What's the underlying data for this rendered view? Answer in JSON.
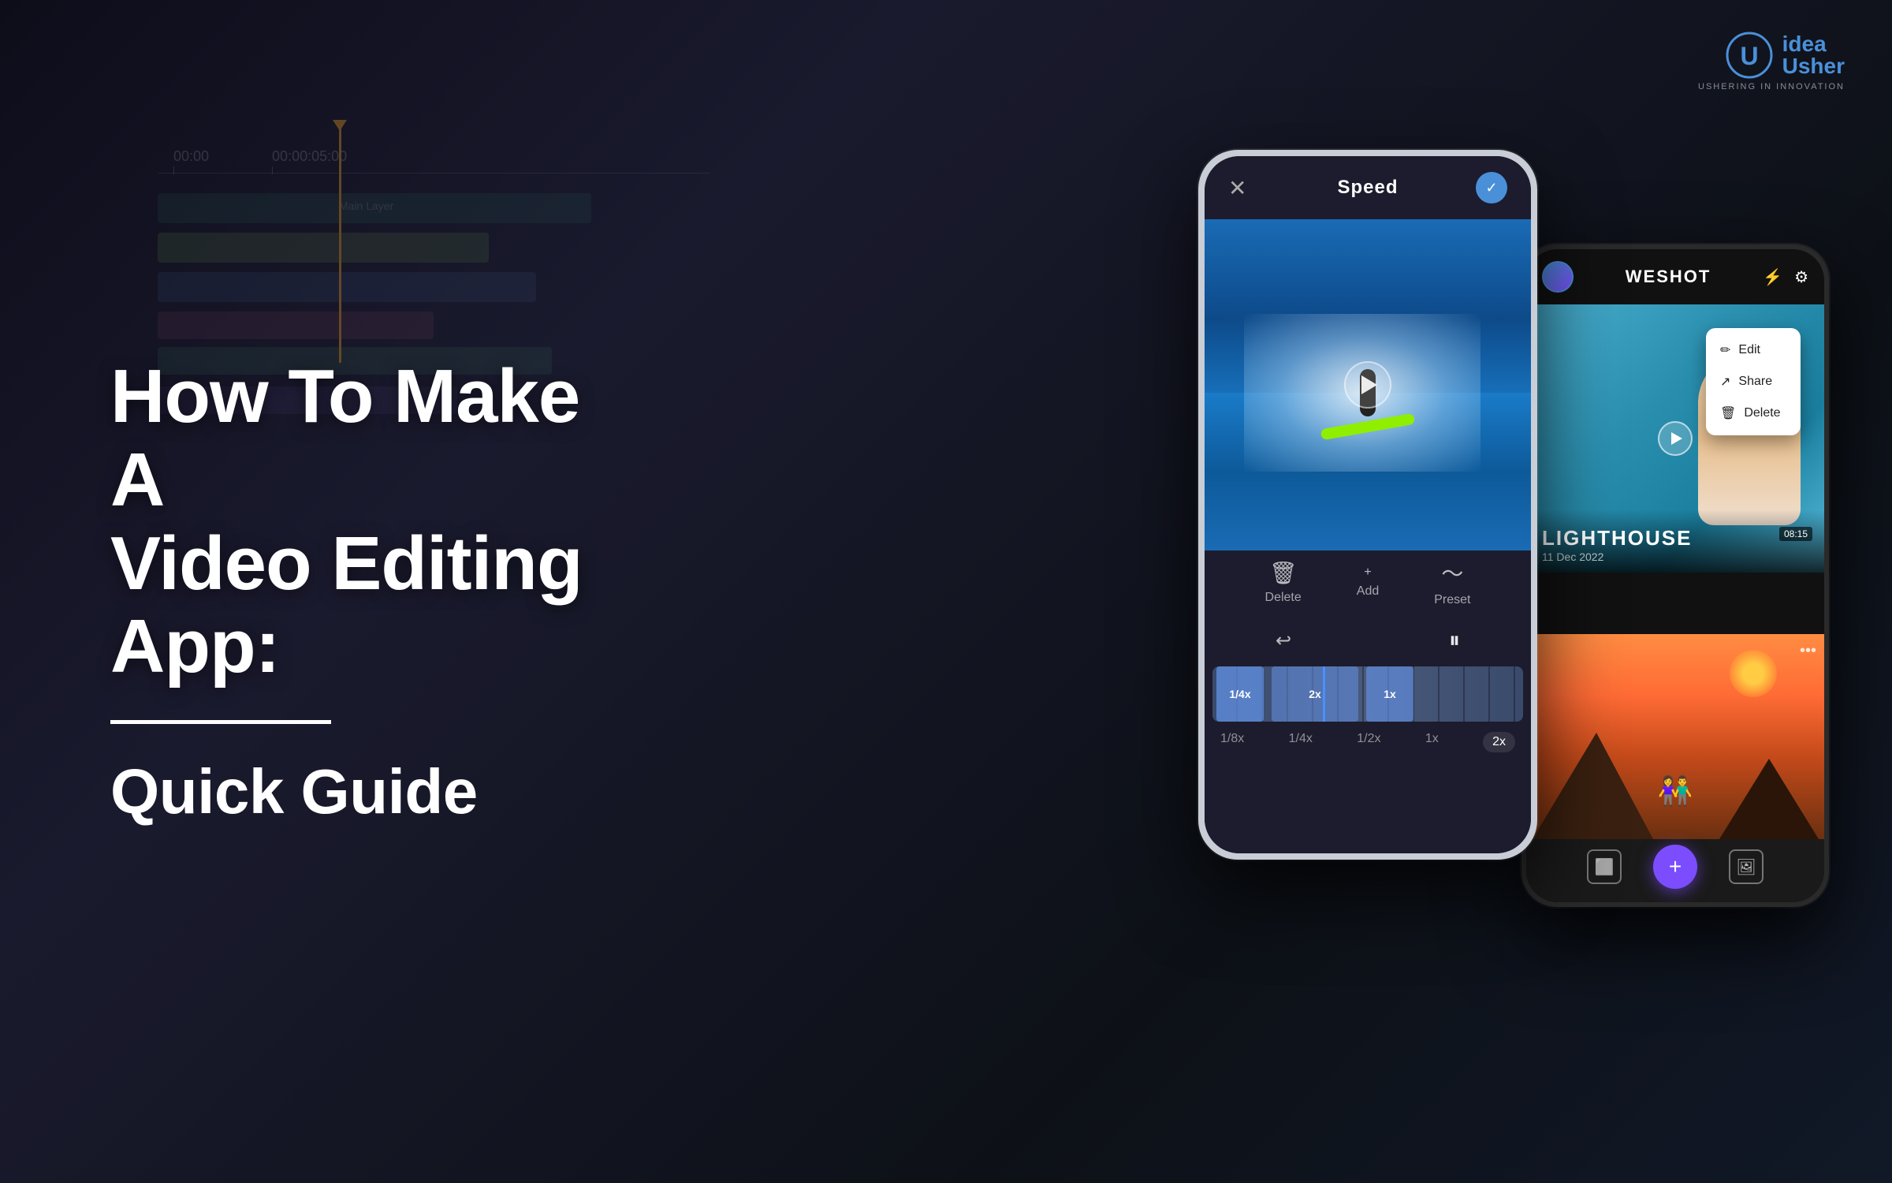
{
  "background": {
    "color": "#1a1a2e"
  },
  "logo": {
    "idea_text": "idea",
    "usher_text": "Usher",
    "tagline": "USHERING IN INNOVATION"
  },
  "headline": {
    "line1": "How To Make A",
    "line2": "Video Editing App:",
    "subheading": "Quick Guide"
  },
  "phone1": {
    "title": "Speed",
    "close_icon": "✕",
    "check_icon": "✓",
    "controls": [
      {
        "icon": "🗑",
        "label": "Delete"
      },
      {
        "icon": "+",
        "label": "Add"
      },
      {
        "icon": "〜",
        "label": "Preset"
      }
    ],
    "speed_values": [
      "1/8x",
      "1/4x",
      "1/2x",
      "1x",
      "2x"
    ],
    "speed_active": "2x",
    "speed_markers": [
      "1/4x",
      "2x",
      "1x"
    ]
  },
  "phone2": {
    "app_name": "WESHOT",
    "context_menu": [
      {
        "icon": "✏️",
        "label": "Edit"
      },
      {
        "icon": "↗️",
        "label": "Share"
      },
      {
        "icon": "🗑",
        "label": "Delete"
      }
    ],
    "video1": {
      "title": "LIGHTHOUSE",
      "date": "11 Dec 2022",
      "duration": "08:15"
    },
    "nav_icons": [
      "⬜",
      "+",
      "🖼"
    ]
  },
  "timeline": {
    "ruler_marks": [
      "00:00",
      "00:00:05:00"
    ],
    "track_label": "Main Layer"
  }
}
